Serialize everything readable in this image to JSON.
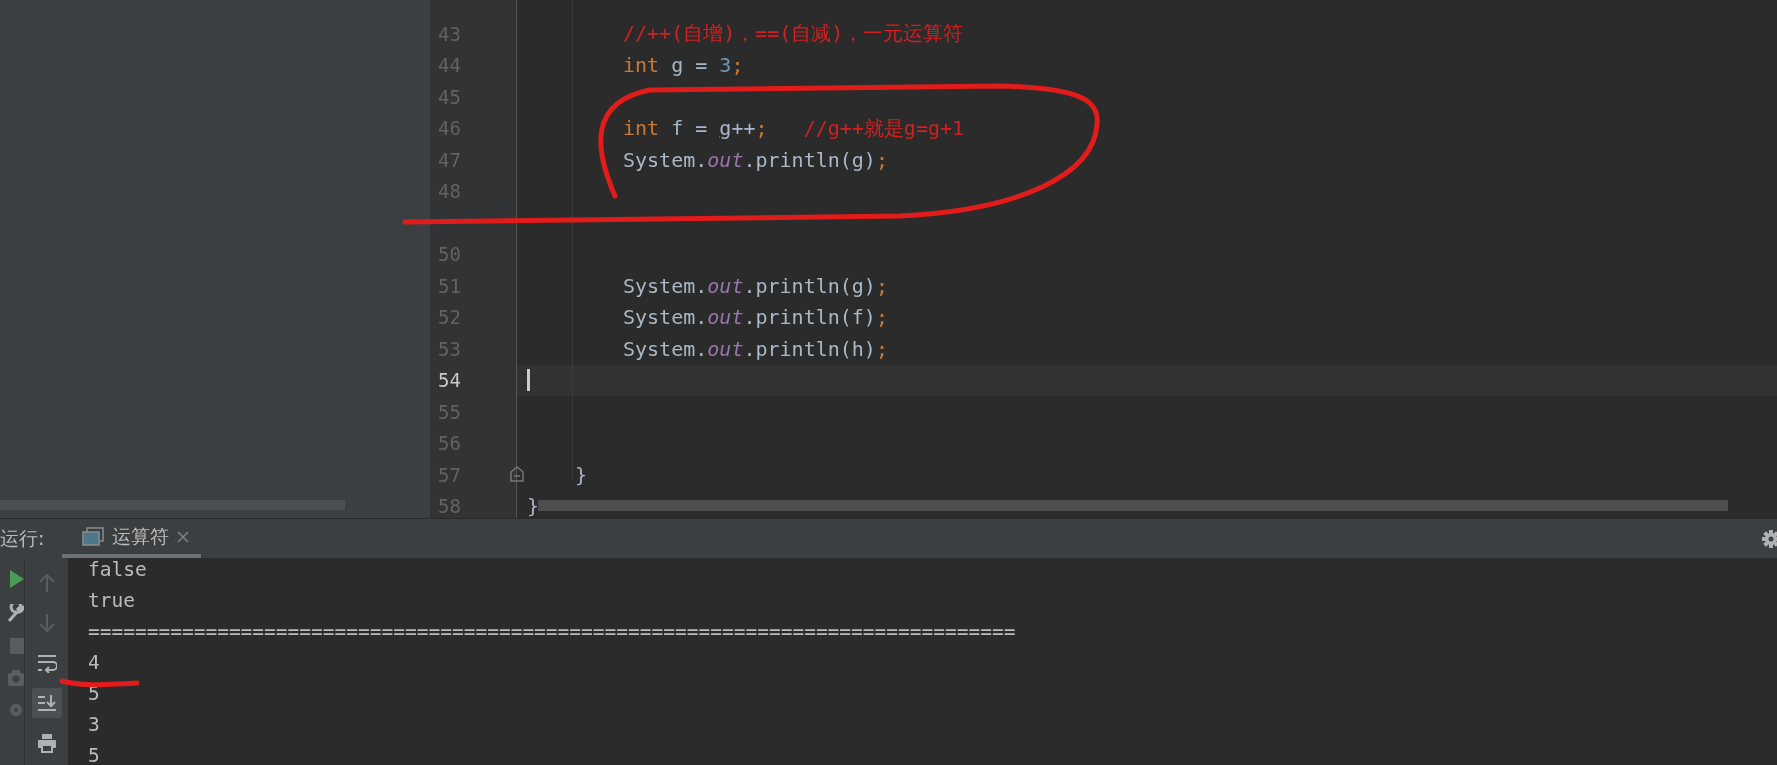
{
  "editor": {
    "lines": [
      {
        "number": "43",
        "kind": "statement",
        "current": false,
        "tokens": [
          {
            "text": "//++(自增)，==(自减)，一元运算符",
            "kind": "comment"
          }
        ]
      },
      {
        "number": "44",
        "kind": "statement",
        "current": false,
        "tokens": [
          {
            "text": "int",
            "kind": "keyword"
          },
          {
            "text": " g = ",
            "kind": "plain"
          },
          {
            "text": "3",
            "kind": "number"
          },
          {
            "text": ";",
            "kind": "punct"
          }
        ]
      },
      {
        "number": "45",
        "kind": "blank",
        "current": false
      },
      {
        "number": "46",
        "kind": "statement",
        "current": false,
        "tokens": [
          {
            "text": "int",
            "kind": "keyword"
          },
          {
            "text": " f = ",
            "kind": "plain"
          },
          {
            "text": "g",
            "kind": "variable"
          },
          {
            "text": "++",
            "kind": "plain"
          },
          {
            "text": ";   ",
            "kind": "punct"
          },
          {
            "text": "//g++就是g=g+1",
            "kind": "comment"
          }
        ]
      },
      {
        "number": "47",
        "kind": "statement",
        "current": false,
        "tokens": [
          {
            "text": "System.",
            "kind": "plain"
          },
          {
            "text": "out",
            "kind": "field"
          },
          {
            "text": ".println(",
            "kind": "plain"
          },
          {
            "text": "g",
            "kind": "variable"
          },
          {
            "text": ")",
            "kind": "plain"
          },
          {
            "text": ";",
            "kind": "punct"
          }
        ]
      },
      {
        "number": "48",
        "kind": "blank",
        "current": false
      },
      {
        "kind": "blank",
        "current": false
      },
      {
        "number": "50",
        "kind": "blank",
        "current": false
      },
      {
        "number": "51",
        "kind": "statement",
        "current": false,
        "tokens": [
          {
            "text": "System.",
            "kind": "plain"
          },
          {
            "text": "out",
            "kind": "field"
          },
          {
            "text": ".println(",
            "kind": "plain"
          },
          {
            "text": "g",
            "kind": "variable"
          },
          {
            "text": ")",
            "kind": "plain"
          },
          {
            "text": ";",
            "kind": "punct"
          }
        ]
      },
      {
        "number": "52",
        "kind": "statement",
        "current": false,
        "tokens": [
          {
            "text": "System.",
            "kind": "plain"
          },
          {
            "text": "out",
            "kind": "field"
          },
          {
            "text": ".println(f)",
            "kind": "plain"
          },
          {
            "text": ";",
            "kind": "punct"
          }
        ]
      },
      {
        "number": "53",
        "kind": "statement",
        "current": false,
        "tokens": [
          {
            "text": "System.",
            "kind": "plain"
          },
          {
            "text": "out",
            "kind": "field"
          },
          {
            "text": ".println(h)",
            "kind": "plain"
          },
          {
            "text": ";",
            "kind": "punct"
          }
        ]
      },
      {
        "number": "54",
        "kind": "blank",
        "current": true
      },
      {
        "number": "55",
        "kind": "blank",
        "current": false
      },
      {
        "number": "56",
        "kind": "blank",
        "current": false
      },
      {
        "number": "57",
        "kind": "method_close",
        "current": false,
        "tokens": [
          {
            "text": "}",
            "kind": "plain"
          }
        ]
      },
      {
        "number": "58",
        "kind": "class_close",
        "current": false,
        "tokens": [
          {
            "text": "}",
            "kind": "plain"
          }
        ]
      }
    ]
  },
  "run_panel": {
    "label": "运行:",
    "tabs": [
      {
        "label": "运算符",
        "selected": true
      }
    ],
    "output": [
      "false",
      "true",
      "===============================================================================",
      "4",
      "5",
      "3",
      "5"
    ]
  }
}
